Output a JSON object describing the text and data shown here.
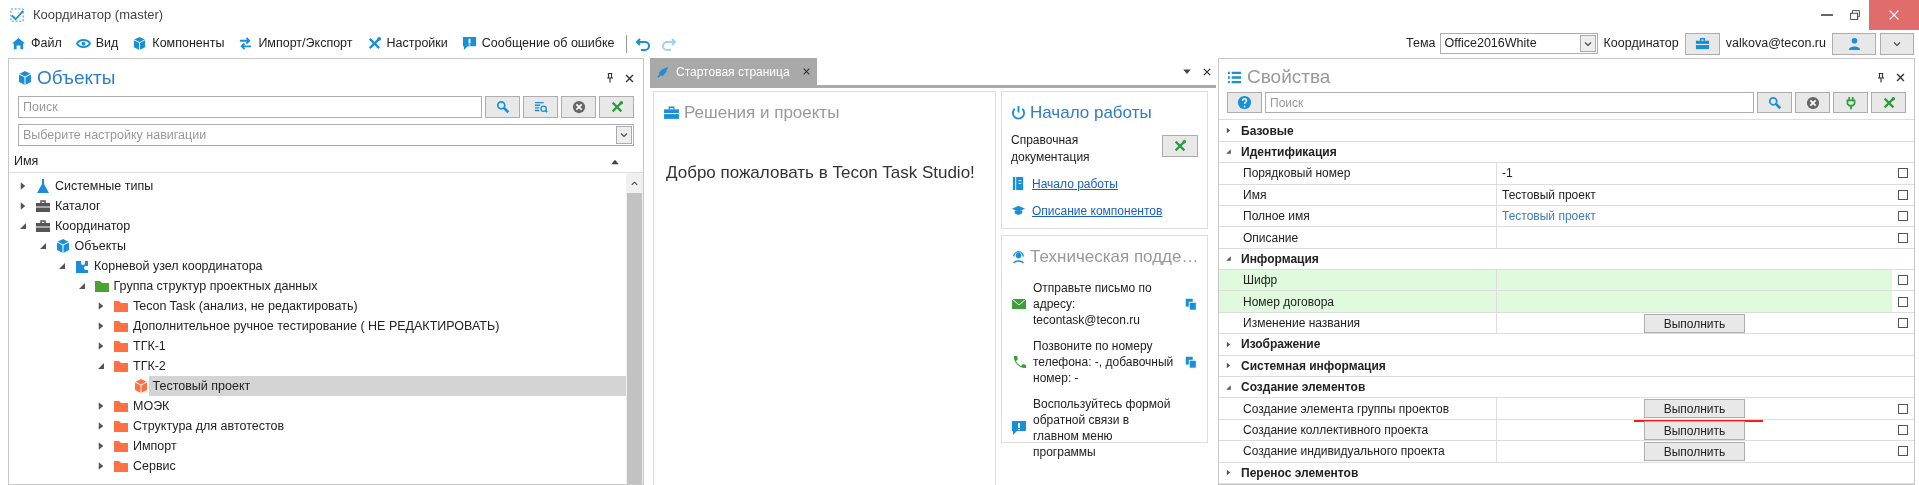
{
  "window": {
    "title": "Координатор (master)"
  },
  "menu": [
    {
      "label": "Файл"
    },
    {
      "label": "Вид"
    },
    {
      "label": "Компоненты"
    },
    {
      "label": "Импорт/Экспорт"
    },
    {
      "label": "Настройки"
    },
    {
      "label": "Сообщение об ошибке"
    }
  ],
  "account_bar": {
    "theme_label": "Тема",
    "theme_value": "Office2016White",
    "role_label": "Координатор",
    "user": "valkova@tecon.ru"
  },
  "objects_panel": {
    "title": "Объекты",
    "search_placeholder": "Поиск",
    "navigation_placeholder": "Выберите настройку навигации",
    "column": "Имя",
    "tree": [
      {
        "label": "Системные типы",
        "kind": "flask",
        "expanded": false,
        "selected": false
      },
      {
        "label": "Каталог",
        "kind": "briefcase",
        "expanded": false,
        "selected": false
      },
      {
        "label": "Координатор",
        "kind": "briefcase",
        "expanded": true,
        "selected": false,
        "children": [
          {
            "label": "Объекты",
            "kind": "cube",
            "expanded": true,
            "selected": false,
            "children": [
              {
                "label": "Корневой узел координатора",
                "kind": "root",
                "expanded": true,
                "selected": false,
                "children": [
                  {
                    "label": "Группа структур проектных данных",
                    "kind": "group",
                    "expanded": true,
                    "selected": false,
                    "children": [
                      {
                        "label": "Tecon Task (анализ, не редактировать)",
                        "kind": "folder",
                        "expanded": false,
                        "selected": false
                      },
                      {
                        "label": "Дополнительное ручное тестирование ( НЕ РЕДАКТИРОВАТЬ)",
                        "kind": "folder",
                        "expanded": false,
                        "selected": false
                      },
                      {
                        "label": "ТГК-1",
                        "kind": "folder",
                        "expanded": false,
                        "selected": false
                      },
                      {
                        "label": "ТГК-2",
                        "kind": "folder",
                        "expanded": true,
                        "selected": false,
                        "children": [
                          {
                            "label": "Тестовый проект",
                            "kind": "project",
                            "selected": true
                          }
                        ]
                      },
                      {
                        "label": "МОЭК",
                        "kind": "folder",
                        "expanded": false,
                        "selected": false
                      },
                      {
                        "label": "Структура для автотестов",
                        "kind": "folder",
                        "expanded": false,
                        "selected": false
                      },
                      {
                        "label": "Импорт",
                        "kind": "folder",
                        "expanded": false,
                        "selected": false
                      },
                      {
                        "label": "Сервис",
                        "kind": "folder",
                        "expanded": false,
                        "selected": false
                      }
                    ]
                  }
                ]
              }
            ]
          }
        ]
      }
    ]
  },
  "start_page": {
    "tab": {
      "label": "Стартовая страница",
      "selected": true
    },
    "solutions_title": "Решения и проекты",
    "welcome": "Добро пожаловать в Tecon Task Studio!",
    "getting_started": {
      "title": "Начало работы",
      "doc_label": "Справочная документация",
      "links": [
        {
          "label": "Начало работы",
          "kind": "book"
        },
        {
          "label": "Описание компонентов",
          "kind": "cap"
        }
      ]
    },
    "support": {
      "title": "Техническая подде…",
      "items": [
        {
          "kind": "mail",
          "text": "Отправьте письмо по адресу: tecontask@tecon.ru",
          "copyable": true
        },
        {
          "kind": "phone",
          "text": "Позвоните по номеру телефона: -, добавочный номер: -",
          "copyable": true
        },
        {
          "kind": "feedback",
          "text": "Воспользуйтесь формой обратной связи в главном меню программы",
          "copyable": false
        }
      ]
    }
  },
  "properties_panel": {
    "title": "Свойства",
    "search_placeholder": "Поиск",
    "rows": [
      {
        "kind": "category",
        "label": "Базовые",
        "expanded": false
      },
      {
        "kind": "category",
        "label": "Идентификация",
        "expanded": true
      },
      {
        "kind": "text",
        "label": "Порядковый номер",
        "value": "-1",
        "highlighted": false,
        "checked": false
      },
      {
        "kind": "text",
        "label": "Имя",
        "value": "Тестовый проект",
        "highlighted": false,
        "checked": false
      },
      {
        "kind": "link",
        "label": "Полное имя",
        "value": "Тестовый проект",
        "highlighted": false,
        "checked": false
      },
      {
        "kind": "text",
        "label": "Описание",
        "highlighted": false,
        "checked": false
      },
      {
        "kind": "category",
        "label": "Информация",
        "expanded": true
      },
      {
        "kind": "text",
        "label": "Шифр",
        "highlighted": true,
        "checked": false
      },
      {
        "kind": "text",
        "label": "Номер договора",
        "highlighted": true,
        "checked": false
      },
      {
        "kind": "action",
        "label": "Изменение названия",
        "button": "Выполнить",
        "checked": false
      },
      {
        "kind": "category",
        "label": "Изображение",
        "expanded": false
      },
      {
        "kind": "category",
        "label": "Системная информация",
        "expanded": false
      },
      {
        "kind": "category",
        "label": "Создание элементов",
        "expanded": true
      },
      {
        "kind": "action",
        "label": "Создание элемента группы проектов",
        "button": "Выполнить",
        "annotated": true,
        "checked": false
      },
      {
        "kind": "action",
        "label": "Создание коллективного проекта",
        "button": "Выполнить",
        "checked": false
      },
      {
        "kind": "action",
        "label": "Создание индивидуального проекта",
        "button": "Выполнить",
        "checked": false
      },
      {
        "kind": "category",
        "label": "Перенос элементов",
        "expanded": false
      }
    ]
  }
}
